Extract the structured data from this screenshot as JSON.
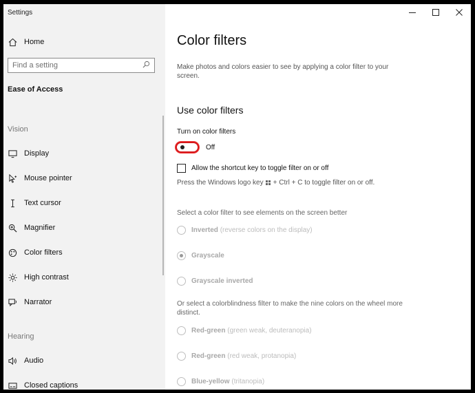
{
  "window": {
    "title": "Settings"
  },
  "sidebar": {
    "home": "Home",
    "search_placeholder": "Find a setting",
    "category": "Ease of Access",
    "groups": {
      "vision": "Vision",
      "hearing": "Hearing"
    },
    "vision_items": [
      {
        "label": "Display",
        "icon": "display-icon"
      },
      {
        "label": "Mouse pointer",
        "icon": "mouse-pointer-icon"
      },
      {
        "label": "Text cursor",
        "icon": "text-cursor-icon"
      },
      {
        "label": "Magnifier",
        "icon": "magnifier-icon"
      },
      {
        "label": "Color filters",
        "icon": "color-filters-icon"
      },
      {
        "label": "High contrast",
        "icon": "high-contrast-icon"
      },
      {
        "label": "Narrator",
        "icon": "narrator-icon"
      }
    ],
    "hearing_items": [
      {
        "label": "Audio",
        "icon": "audio-icon"
      },
      {
        "label": "Closed captions",
        "icon": "closed-captions-icon"
      }
    ]
  },
  "main": {
    "title": "Color filters",
    "description": "Make photos and colors easier to see by applying a color filter to your screen.",
    "section_title": "Use color filters",
    "toggle_label": "Turn on color filters",
    "toggle_state": "Off",
    "shortcut_checkbox": "Allow the shortcut key to toggle filter on or off",
    "hint_prefix": "Press the Windows logo key",
    "hint_suffix": "+ Ctrl + C to toggle filter on or off.",
    "select_label": "Select a color filter to see elements on the screen better",
    "filters": [
      {
        "name": "Inverted",
        "detail": "(reverse colors on the display)",
        "checked": false
      },
      {
        "name": "Grayscale",
        "detail": "",
        "checked": true
      },
      {
        "name": "Grayscale inverted",
        "detail": "",
        "checked": false
      }
    ],
    "colorblind_label": "Or select a colorblindness filter to make the nine colors on the wheel more distinct.",
    "colorblind_filters": [
      {
        "name": "Red-green",
        "detail": "(green weak, deuteranopia)"
      },
      {
        "name": "Red-green",
        "detail": "(red weak, protanopia)"
      },
      {
        "name": "Blue-yellow",
        "detail": "(tritanopia)"
      }
    ]
  },
  "colors": {
    "accent_toggle_border": "#d6181b",
    "sidebar_bg": "#f2f2f2"
  }
}
